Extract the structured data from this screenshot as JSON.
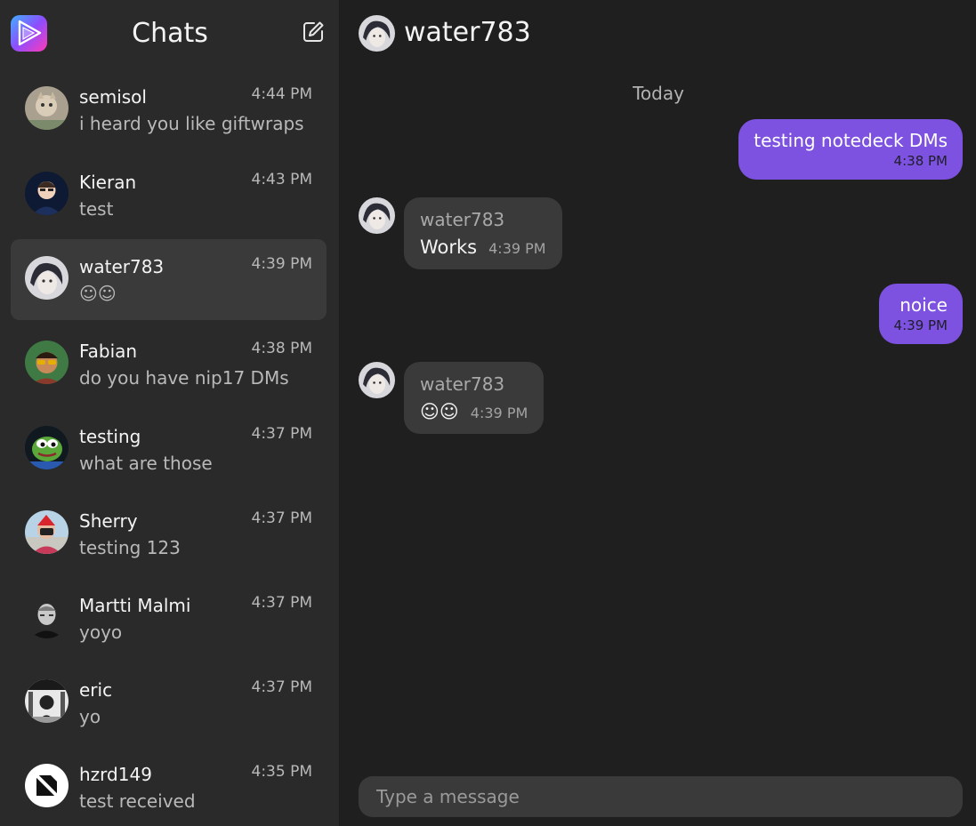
{
  "sidebar": {
    "title": "Chats",
    "chats": [
      {
        "name": "semisol",
        "time": "4:44 PM",
        "preview": "i heard you like giftwraps"
      },
      {
        "name": "Kieran",
        "time": "4:43 PM",
        "preview": "test"
      },
      {
        "name": "water783",
        "time": "4:39 PM",
        "preview": "☺☺"
      },
      {
        "name": "Fabian",
        "time": "4:38 PM",
        "preview": "do you have nip17 DMs"
      },
      {
        "name": "testing",
        "time": "4:37 PM",
        "preview": "what are those"
      },
      {
        "name": "Sherry",
        "time": "4:37 PM",
        "preview": "testing 123"
      },
      {
        "name": "Martti Malmi",
        "time": "4:37 PM",
        "preview": "yoyo"
      },
      {
        "name": "eric",
        "time": "4:37 PM",
        "preview": "yo"
      },
      {
        "name": "hzrd149",
        "time": "4:35 PM",
        "preview": "test received"
      }
    ]
  },
  "conversation": {
    "name": "water783",
    "date_separator": "Today",
    "messages": [
      {
        "direction": "out",
        "text": "testing notedeck DMs",
        "time": "4:38 PM"
      },
      {
        "direction": "in",
        "author": "water783",
        "text": "Works",
        "time": "4:39 PM"
      },
      {
        "direction": "out",
        "text": "noice",
        "time": "4:39 PM"
      },
      {
        "direction": "in",
        "author": "water783",
        "text": "☺☺",
        "time": "4:39 PM"
      }
    ],
    "composer_placeholder": "Type a message"
  },
  "colors": {
    "accent": "#7d52e0",
    "sidebar_bg": "#2a2a2a",
    "main_bg": "#1f1f1f",
    "active_row": "#3a3a3a"
  },
  "icons": [
    "app-logo-icon",
    "compose-icon"
  ]
}
